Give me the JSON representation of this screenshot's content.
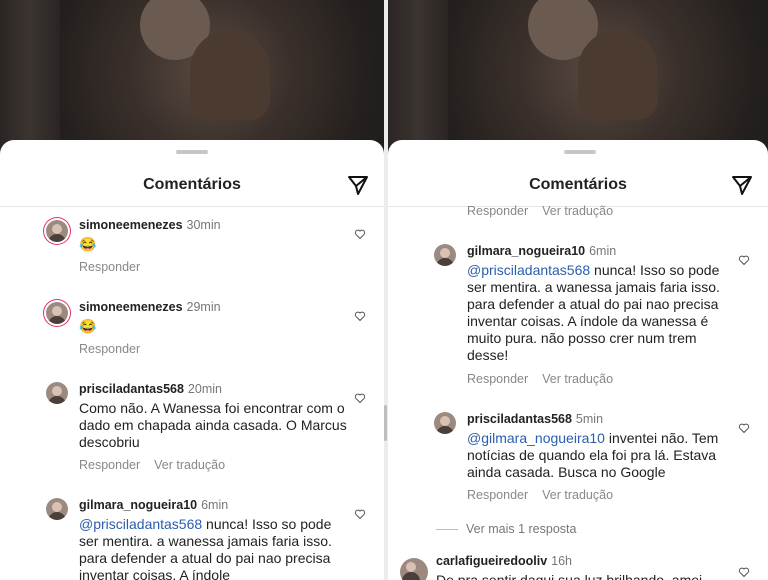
{
  "left": {
    "title": "Comentários",
    "comments": [
      {
        "user": "simoneemenezes",
        "time": "30min",
        "text": "😂",
        "reply": "Responder",
        "translate": ""
      },
      {
        "user": "simoneemenezes",
        "time": "29min",
        "text": "😂",
        "reply": "Responder",
        "translate": ""
      },
      {
        "user": "prisciladantas568",
        "time": "20min",
        "text": "Como não. A Wanessa foi encontrar com o dado em chapada ainda casada. O Marcus descobriu",
        "reply": "Responder",
        "translate": "Ver tradução"
      },
      {
        "user": "gilmara_nogueira10",
        "time": "6min",
        "mention": "@prisciladantas568",
        "text": " nunca! Isso so pode ser mentira. a wanessa jamais faria isso. para defender a atual do pai nao precisa inventar coisas. A índole",
        "reply": "",
        "translate": ""
      }
    ]
  },
  "right": {
    "title": "Comentários",
    "top_actions": {
      "reply": "Responder",
      "translate": "Ver tradução"
    },
    "comments": [
      {
        "user": "gilmara_nogueira10",
        "time": "6min",
        "mention": "@prisciladantas568",
        "text": " nunca! Isso so pode ser mentira. a wanessa jamais faria isso. para defender a atual do pai nao precisa inventar coisas. A índole da wanessa é muito pura. não posso crer num trem desse!",
        "reply": "Responder",
        "translate": "Ver tradução"
      },
      {
        "user": "prisciladantas568",
        "time": "5min",
        "mention": "@gilmara_nogueira10",
        "text": " inventei não. Tem notícias de quando ela foi pra lá. Estava ainda casada. Busca no Google",
        "reply": "Responder",
        "translate": "Ver tradução"
      },
      {
        "user": "carlafigueiredooliv",
        "time": "16h",
        "text": "De pra sentir daqui sua luz brilhando, amei",
        "reply": "",
        "translate": ""
      }
    ],
    "more_replies": "Ver mais 1 resposta"
  }
}
